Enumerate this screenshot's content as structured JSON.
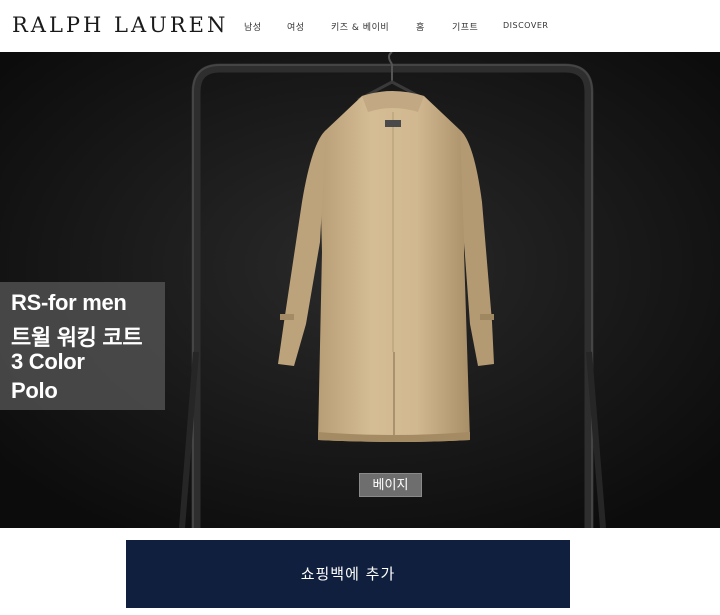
{
  "header": {
    "logo": "RALPH LAUREN",
    "nav": [
      {
        "label": "남성",
        "name": "nav-item-men"
      },
      {
        "label": "여성",
        "name": "nav-item-women"
      },
      {
        "label": "키즈 & 베이비",
        "name": "nav-item-kids-baby"
      },
      {
        "label": "홈",
        "name": "nav-item-home"
      },
      {
        "label": "기프트",
        "name": "nav-item-gift"
      },
      {
        "label": "DISCOVER",
        "name": "nav-item-discover"
      }
    ]
  },
  "hero": {
    "overlay_lines": [
      "RS-for men",
      "트윌 워킹 코트",
      "3 Color",
      "Polo"
    ],
    "color_label": "베이지"
  },
  "cart": {
    "button_label": "쇼핑백에  추가"
  },
  "colors": {
    "header_bg": "#ffffff",
    "hero_bg": "#141414",
    "coat": "#cdb48d",
    "button_bg": "#0f1f3d"
  }
}
